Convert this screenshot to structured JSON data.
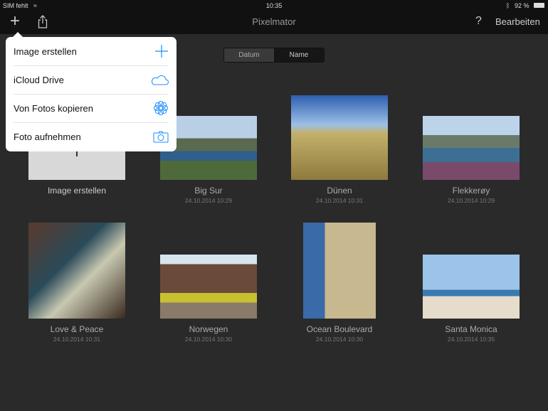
{
  "status": {
    "carrier": "SIM fehlt",
    "time": "10:35",
    "battery": "92 %"
  },
  "nav": {
    "title": "Pixelmator",
    "edit": "Bearbeiten",
    "help": "?"
  },
  "sort": {
    "options": [
      "Datum",
      "Name"
    ],
    "selected": "Name"
  },
  "menu": [
    {
      "label": "Image erstellen",
      "icon": "plus-icon"
    },
    {
      "label": "iCloud Drive",
      "icon": "cloud-icon"
    },
    {
      "label": "Von Fotos kopieren",
      "icon": "photos-flower-icon"
    },
    {
      "label": "Foto aufnehmen",
      "icon": "camera-icon"
    }
  ],
  "accent": "#1a8cff",
  "gallery": [
    {
      "title": "Image erstellen",
      "date": ""
    },
    {
      "title": "Big Sur",
      "date": "24.10.2014 10:29"
    },
    {
      "title": "Dünen",
      "date": "24.10.2014 10:31"
    },
    {
      "title": "Flekkerøy",
      "date": "24.10.2014 10:29"
    },
    {
      "title": "Love & Peace",
      "date": "24.10.2014 10:31"
    },
    {
      "title": "Norwegen",
      "date": "24.10.2014 10:30"
    },
    {
      "title": "Ocean Boulevard",
      "date": "24.10.2014 10:30"
    },
    {
      "title": "Santa Monica",
      "date": "24.10.2014 10:35"
    }
  ]
}
